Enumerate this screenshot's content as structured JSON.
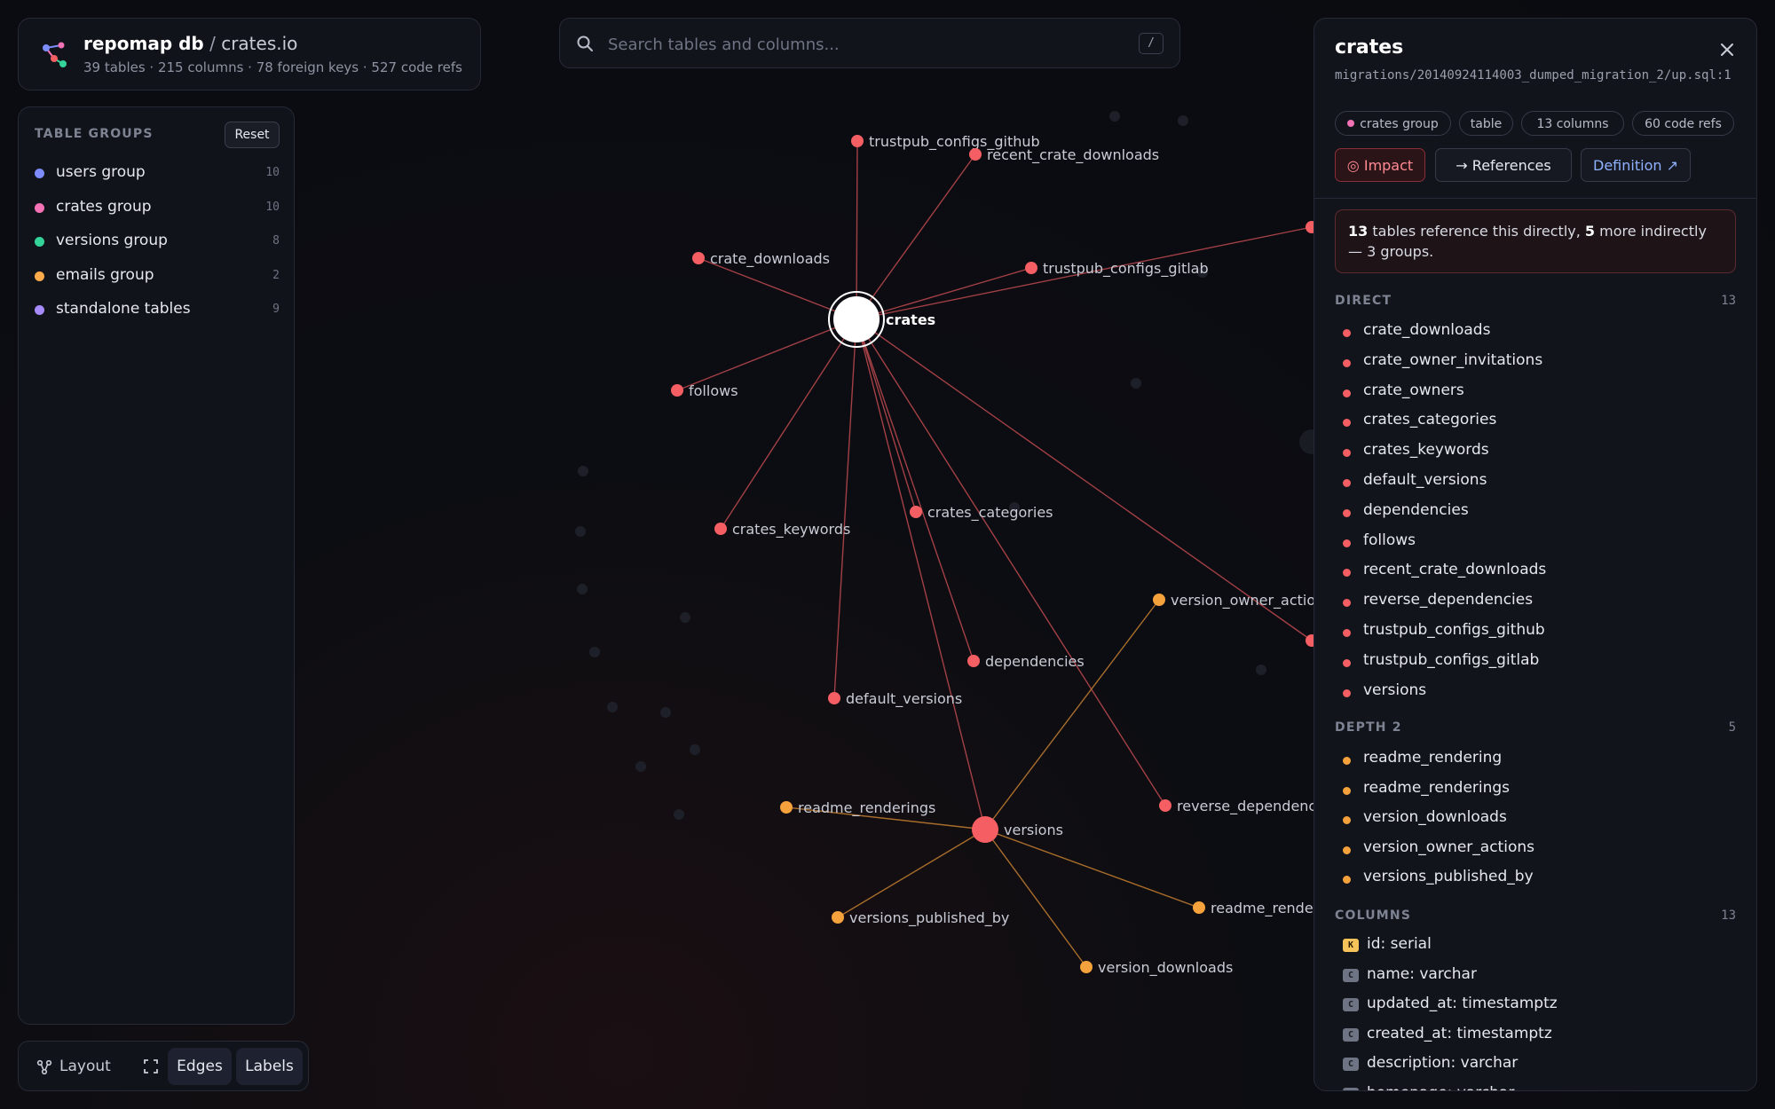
{
  "app": {
    "name": "repomap db",
    "separator": "/",
    "project": "crates.io",
    "stats": "39 tables · 215 columns · 78 foreign keys · 527 code refs"
  },
  "search": {
    "placeholder": "Search tables and columns...",
    "value": "",
    "shortcut": "/"
  },
  "groups": {
    "title": "TABLE GROUPS",
    "reset_label": "Reset",
    "items": [
      {
        "label": "users group",
        "count": "10",
        "color": "#7c8cf8"
      },
      {
        "label": "crates group",
        "count": "10",
        "color": "#f472b6"
      },
      {
        "label": "versions group",
        "count": "8",
        "color": "#34d399"
      },
      {
        "label": "emails group",
        "count": "2",
        "color": "#fbab4a"
      },
      {
        "label": "standalone tables",
        "count": "9",
        "color": "#a78bfa"
      }
    ]
  },
  "toolbar": {
    "layout_label": "Layout",
    "edges_label": "Edges",
    "labels_label": "Labels"
  },
  "graph": {
    "center": {
      "id": "crates",
      "label": "crates"
    },
    "nodes": [
      {
        "id": "trustpub_configs_github",
        "label": "trustpub_configs_github",
        "depth": 1
      },
      {
        "id": "recent_crate_downloads",
        "label": "recent_crate_downloads",
        "depth": 1
      },
      {
        "id": "crate_downloads",
        "label": "crate_downloads",
        "depth": 1
      },
      {
        "id": "trustpub_configs_gitlab",
        "label": "trustpub_configs_gitlab",
        "depth": 1
      },
      {
        "id": "follows",
        "label": "follows",
        "depth": 1
      },
      {
        "id": "crates_keywords",
        "label": "crates_keywords",
        "depth": 1
      },
      {
        "id": "crates_categories",
        "label": "crates_categories",
        "depth": 1
      },
      {
        "id": "version_owner_actions",
        "label": "version_owner_actio",
        "depth": 2
      },
      {
        "id": "dependencies",
        "label": "dependencies",
        "depth": 1
      },
      {
        "id": "default_versions",
        "label": "default_versions",
        "depth": 1
      },
      {
        "id": "readme_renderings",
        "label": "readme_renderings",
        "depth": 2
      },
      {
        "id": "versions",
        "label": "versions",
        "depth": 1
      },
      {
        "id": "reverse_dependencies",
        "label": "reverse_dependencie",
        "depth": 1
      },
      {
        "id": "versions_published_by",
        "label": "versions_published_by",
        "depth": 2
      },
      {
        "id": "readme_rendering",
        "label": "readme_render",
        "depth": 2
      },
      {
        "id": "version_downloads",
        "label": "version_downloads",
        "depth": 2
      },
      {
        "id": "crate_owners",
        "label": "",
        "depth": 1
      },
      {
        "id": "crate_owner_invitations",
        "label": "",
        "depth": 1
      }
    ],
    "edges": [
      [
        "crates",
        "trustpub_configs_github"
      ],
      [
        "crates",
        "recent_crate_downloads"
      ],
      [
        "crates",
        "crate_downloads"
      ],
      [
        "crates",
        "trustpub_configs_gitlab"
      ],
      [
        "crates",
        "follows"
      ],
      [
        "crates",
        "crates_keywords"
      ],
      [
        "crates",
        "crates_categories"
      ],
      [
        "crates",
        "dependencies"
      ],
      [
        "crates",
        "default_versions"
      ],
      [
        "crates",
        "versions"
      ],
      [
        "crates",
        "reverse_dependencies"
      ],
      [
        "crates",
        "crate_owners"
      ],
      [
        "crates",
        "crate_owner_invitations"
      ],
      [
        "versions",
        "version_owner_actions"
      ],
      [
        "versions",
        "readme_renderings"
      ],
      [
        "versions",
        "versions_published_by"
      ],
      [
        "versions",
        "readme_rendering"
      ],
      [
        "versions",
        "version_downloads"
      ]
    ],
    "depth1_color": "#f55f63",
    "depth2_color": "#f6a23c",
    "edge1_color": "#b3464c",
    "edge2_color": "#b9782e"
  },
  "details": {
    "title": "crates",
    "path": "migrations/20140924114003_dumped_migration_2/up.sql:1",
    "chips": {
      "group": "crates group",
      "type": "table",
      "columns": "13 columns",
      "refs": "60 code refs"
    },
    "buttons": {
      "impact": "◎ Impact",
      "references": "→ References",
      "definition": "Definition ↗"
    },
    "impact": {
      "direct_count": "13",
      "text_a": "tables reference this directly,",
      "indirect_count": "5",
      "text_b": "more indirectly — 3 groups."
    },
    "direct": {
      "title": "DIRECT",
      "count": "13",
      "items": [
        "crate_downloads",
        "crate_owner_invitations",
        "crate_owners",
        "crates_categories",
        "crates_keywords",
        "default_versions",
        "dependencies",
        "follows",
        "recent_crate_downloads",
        "reverse_dependencies",
        "trustpub_configs_github",
        "trustpub_configs_gitlab",
        "versions"
      ]
    },
    "depth2": {
      "title": "DEPTH 2",
      "count": "5",
      "items": [
        "readme_rendering",
        "readme_renderings",
        "version_downloads",
        "version_owner_actions",
        "versions_published_by"
      ]
    },
    "columns": {
      "title": "COLUMNS",
      "count": "13",
      "items": [
        {
          "badge": "K",
          "kind": "k",
          "label": "id: serial"
        },
        {
          "badge": "C",
          "kind": "c",
          "label": "name: varchar"
        },
        {
          "badge": "C",
          "kind": "c",
          "label": "updated_at: timestamptz"
        },
        {
          "badge": "C",
          "kind": "c",
          "label": "created_at: timestamptz"
        },
        {
          "badge": "C",
          "kind": "c",
          "label": "description: varchar"
        },
        {
          "badge": "C",
          "kind": "c",
          "label": "homepage: varchar"
        }
      ]
    }
  }
}
